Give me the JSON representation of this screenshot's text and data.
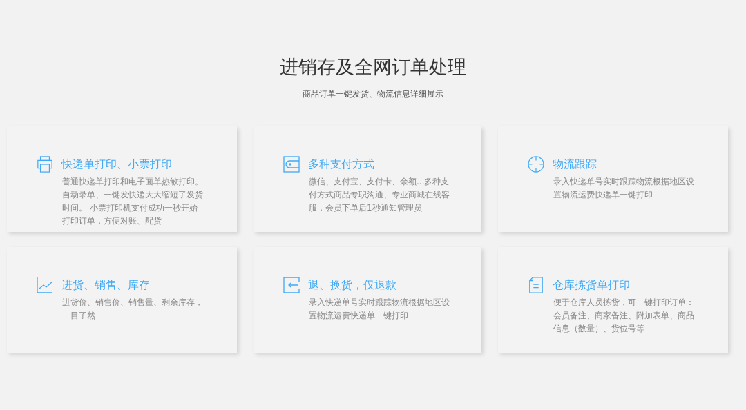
{
  "header": {
    "title": "进销存及全网订单处理",
    "subtitle": "商品订单一键发货、物流信息详细展示"
  },
  "features": [
    {
      "kind": "printer",
      "title": "快递单打印、小票打印",
      "text": "普通快递单打印和电子面单热敏打印。自动录单、一键发快递大大缩短了发货时间。 小票打印机支付成功一秒开始打印订单，方便对账、配货"
    },
    {
      "kind": "wallet",
      "title": "多种支付方式",
      "text": "微信、支付宝、支付卡、余额...多种支付方式商品专职沟通、专业商城在线客服，会员下单后1秒通知管理员"
    },
    {
      "kind": "crosshair",
      "title": "物流跟踪",
      "text": "录入快递单号实时跟踪物流根据地区设置物流运费快递单一键打印"
    },
    {
      "kind": "chart",
      "title": "进货、销售、库存",
      "text": "进货价、销售价、销售量、剩余库存，一目了然"
    },
    {
      "kind": "return",
      "title": "退、换货，仅退款",
      "text": "录入快递单号实时跟踪物流根据地区设置物流运费快递单一键打印"
    },
    {
      "kind": "document",
      "title": "仓库拣货单打印",
      "text": "便于仓库人员拣货，可一键打印订单：会员备注、商家备注、附加表单、商品信息（数量）、货位号等"
    }
  ]
}
